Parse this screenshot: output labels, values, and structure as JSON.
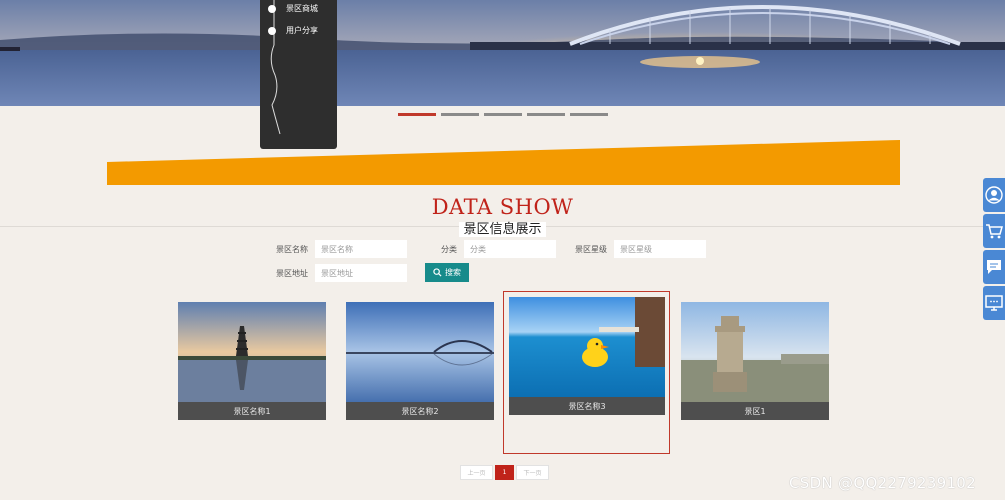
{
  "nav": {
    "items": [
      {
        "label": "景区商城"
      },
      {
        "label": "用户分享"
      }
    ]
  },
  "slider": {
    "count": 5,
    "active": 0
  },
  "section": {
    "title_en": "DATA SHOW",
    "title_cn": "景区信息展示"
  },
  "search": {
    "name_label": "景区名称",
    "name_placeholder": "景区名称",
    "category_label": "分类",
    "category_placeholder": "分类",
    "rating_label": "景区星级",
    "rating_placeholder": "景区星级",
    "address_label": "景区地址",
    "address_placeholder": "景区地址",
    "button_label": "搜索"
  },
  "cards": [
    {
      "caption": "景区名称1"
    },
    {
      "caption": "景区名称2"
    },
    {
      "caption": "景区名称3"
    },
    {
      "caption": "景区1"
    }
  ],
  "pager": {
    "prev_label": "上一页",
    "current": "1",
    "next_label": "下一页"
  },
  "float_bar": {
    "icons": [
      "user-icon",
      "cart-icon",
      "chat-icon",
      "monitor-icon"
    ]
  },
  "watermark": "CSDN @QQ2279239102",
  "colors": {
    "accent_red": "#c0231a",
    "orange_band": "#f39a00",
    "search_button": "#178b8b",
    "float_bar": "#4a88d4"
  }
}
